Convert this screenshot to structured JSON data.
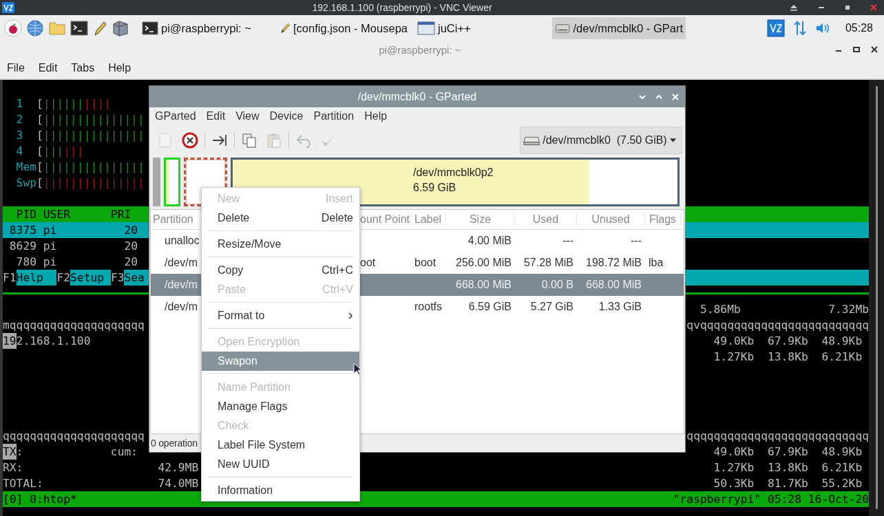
{
  "vnc_window": {
    "title": "192.168.1.100 (raspberrypi) - VNC Viewer"
  },
  "taskbar": {
    "tasks": [
      {
        "kind": "terminal",
        "label": "pi@raspberrypi: ~",
        "selected": false
      },
      {
        "kind": "editor",
        "label": "[config.json - Mousepa",
        "selected": false
      },
      {
        "kind": "window",
        "label": "juCi++",
        "selected": false
      },
      {
        "kind": "disk",
        "label": "/dev/mmcblk0 - GPart",
        "selected": true
      }
    ],
    "clock": "05:28"
  },
  "terminal": {
    "title": "pi@raspberrypi: ~",
    "menu": [
      "File",
      "Edit",
      "Tabs",
      "Help"
    ],
    "rows": [
      {
        "kind": "blank"
      },
      {
        "kind": "plain",
        "left": [
          {
            "text": "  1",
            "kind": "label"
          },
          {
            "text": "  ["
          },
          {
            "text": "||||||",
            "color": "#189418"
          },
          {
            "text": "||||",
            "color": "#a51414"
          }
        ]
      },
      {
        "kind": "plain",
        "left": [
          {
            "text": "  2",
            "kind": "label"
          },
          {
            "text": "  ["
          },
          {
            "text": "|||||||||||||||",
            "color": "#189418"
          }
        ]
      },
      {
        "kind": "plain",
        "left": [
          {
            "text": "  3",
            "kind": "label"
          },
          {
            "text": "  ["
          },
          {
            "text": "|||||||||||||||",
            "color": "#189418"
          }
        ]
      },
      {
        "kind": "plain",
        "left": [
          {
            "text": "  4",
            "kind": "label"
          },
          {
            "text": "  ["
          },
          {
            "text": "|||",
            "color": "#189418"
          },
          {
            "text": "|||",
            "color": "#a51414"
          }
        ]
      },
      {
        "kind": "plain",
        "left": [
          {
            "text": "  Mem",
            "kind": "label"
          },
          {
            "text": "["
          },
          {
            "text": "|||||||||||||||",
            "color": "#189418"
          }
        ]
      },
      {
        "kind": "plain",
        "left": [
          {
            "text": "  Swp",
            "kind": "label"
          },
          {
            "text": "["
          },
          {
            "text": "|||||||||||||||",
            "color": "#a51414"
          }
        ]
      },
      {
        "kind": "blank"
      },
      {
        "kind": "header",
        "left": [
          {
            "text": "  PID USER      PRI"
          }
        ]
      },
      {
        "kind": "selected",
        "left": [
          {
            "text": " 8375 pi          20"
          }
        ]
      },
      {
        "kind": "plain",
        "left": [
          {
            "text": " 8629 pi          20"
          }
        ]
      },
      {
        "kind": "plain",
        "left": [
          {
            "text": "  780 pi          20"
          }
        ]
      },
      {
        "kind": "fkeys",
        "left": [
          {
            "text": "F1"
          },
          {
            "text": "Help  ",
            "kind": "key_label"
          },
          {
            "text": "F2"
          },
          {
            "text": "Setup ",
            "kind": "key_label"
          },
          {
            "text": "F3"
          },
          {
            "text": "Sea",
            "kind": "key_label"
          }
        ]
      },
      {
        "kind": "rule"
      },
      {
        "kind": "plain",
        "right": [
          {
            "text": "5.86Mb             7.32Mb"
          }
        ]
      },
      {
        "kind": "plain",
        "left": [
          {
            "text": "mqqqqqqqqqqqqqqqqqqqq"
          }
        ],
        "right": [
          {
            "text": "qvqqqqqqqqqqqqqqqqqqqqqqqqq"
          }
        ]
      },
      {
        "kind": "plain",
        "left": [
          {
            "text": "19",
            "kind": "cursor"
          },
          {
            "text": "2.168.1.100"
          }
        ],
        "right": [
          {
            "text": "49.0Kb  67.9Kb  48.9Kb "
          }
        ]
      },
      {
        "kind": "plain",
        "right": [
          {
            "text": "1.27Kb  13.8Kb  6.21Kb "
          }
        ]
      },
      {
        "kind": "blank"
      },
      {
        "kind": "blank"
      },
      {
        "kind": "blank"
      },
      {
        "kind": "blank"
      },
      {
        "kind": "plain",
        "left": [
          {
            "text": "qqqqqqqqqqqqqqqqqqqqq"
          }
        ],
        "right": [
          {
            "text": "qqqqqqqqqqqqqqqqqqqqqqqqqqq"
          }
        ]
      },
      {
        "kind": "plain",
        "left": [
          {
            "text": "TX",
            "kind": "cursor"
          },
          {
            "text": ":             cum:"
          }
        ],
        "right": [
          {
            "text": "49.0Kb  67.9Kb  48.9Kb "
          }
        ]
      },
      {
        "kind": "plain",
        "left": [
          {
            "text": "RX:                    42.9MB"
          }
        ],
        "right": [
          {
            "text": "1.27Kb  13.8Kb  6.21Kb "
          }
        ]
      },
      {
        "kind": "plain",
        "left": [
          {
            "text": "TOTAL:                 74.0MB"
          }
        ],
        "right": [
          {
            "text": "50.3Kb  81.7Kb  55.2Kb "
          }
        ]
      },
      {
        "kind": "status",
        "left": [
          {
            "text": "[0] 0:htop*"
          }
        ],
        "right": [
          {
            "text": "\"raspberrypi\" 05:28 16-Oct-20"
          }
        ]
      }
    ]
  },
  "gparted": {
    "title": "/dev/mmcblk0 - GParted",
    "menu": [
      "GParted",
      "Edit",
      "View",
      "Device",
      "Partition",
      "Help"
    ],
    "toolbar": [
      {
        "kind": "new",
        "disabled": true
      },
      {
        "kind": "delete",
        "disabled": false
      },
      {
        "kind": "separator"
      },
      {
        "kind": "resize",
        "disabled": false
      },
      {
        "kind": "separator"
      },
      {
        "kind": "copy",
        "disabled": false
      },
      {
        "kind": "paste",
        "disabled": true
      },
      {
        "kind": "separator"
      },
      {
        "kind": "undo",
        "disabled": true
      },
      {
        "kind": "apply",
        "disabled": true
      }
    ],
    "device": "/dev/mmcblk0  (7.50 GiB)",
    "graph": [
      {
        "kind": "unallocated"
      },
      {
        "kind": "fat32"
      },
      {
        "kind": "swap"
      },
      {
        "kind": "ext4",
        "name": "/dev/mmcblk0p2",
        "size": "6.59 GiB",
        "level": 0.8
      }
    ],
    "table": {
      "columns": [
        "Partition",
        "ount Point",
        "Label",
        "Size",
        "Used",
        "Unused",
        "Flags"
      ],
      "rows": [
        {
          "partition": "unalloc",
          "size": "4.00 MiB",
          "used": "---",
          "unused": "---",
          "selected": false
        },
        {
          "partition": "/dev/m",
          "mount_point": "oot",
          "label": "boot",
          "size": "256.00 MiB",
          "used": "57.28 MiB",
          "unused": "198.72 MiB",
          "flags": "lba",
          "selected": false
        },
        {
          "partition": "/dev/m",
          "size": "668.00 MiB",
          "used": "0.00 B",
          "unused": "668.00 MiB",
          "selected": true
        },
        {
          "partition": "/dev/m",
          "label": "rootfs",
          "size": "6.59 GiB",
          "used": "5.27 GiB",
          "unused": "1.33 GiB",
          "selected": false
        }
      ]
    },
    "status": "0 operation"
  },
  "context_menu": {
    "items": [
      {
        "kind": "item",
        "label": "New",
        "shortcut": "Insert",
        "disabled": true,
        "selected": false
      },
      {
        "kind": "item",
        "label": "Delete",
        "shortcut": "Delete",
        "disabled": false,
        "selected": false
      },
      {
        "kind": "separator"
      },
      {
        "kind": "item",
        "label": "Resize/Move",
        "disabled": false,
        "selected": false
      },
      {
        "kind": "separator"
      },
      {
        "kind": "item",
        "label": "Copy",
        "shortcut": "Ctrl+C",
        "disabled": false,
        "selected": false
      },
      {
        "kind": "item",
        "label": "Paste",
        "shortcut": "Ctrl+V",
        "disabled": true,
        "selected": false
      },
      {
        "kind": "separator"
      },
      {
        "kind": "submenu",
        "label": "Format to",
        "disabled": false,
        "selected": false
      },
      {
        "kind": "separator"
      },
      {
        "kind": "item",
        "label": "Open Encryption",
        "disabled": true,
        "selected": false
      },
      {
        "kind": "item",
        "label": "Swapon",
        "disabled": false,
        "selected": true
      },
      {
        "kind": "separator"
      },
      {
        "kind": "item",
        "label": "Name Partition",
        "disabled": true,
        "selected": false
      },
      {
        "kind": "item",
        "label": "Manage Flags",
        "disabled": false,
        "selected": false
      },
      {
        "kind": "item",
        "label": "Check",
        "disabled": true,
        "selected": false
      },
      {
        "kind": "item",
        "label": "Label File System",
        "disabled": false,
        "selected": false
      },
      {
        "kind": "item",
        "label": "New UUID",
        "disabled": false,
        "selected": false
      },
      {
        "kind": "separator"
      },
      {
        "kind": "item",
        "label": "Information",
        "disabled": false,
        "selected": false
      }
    ]
  }
}
